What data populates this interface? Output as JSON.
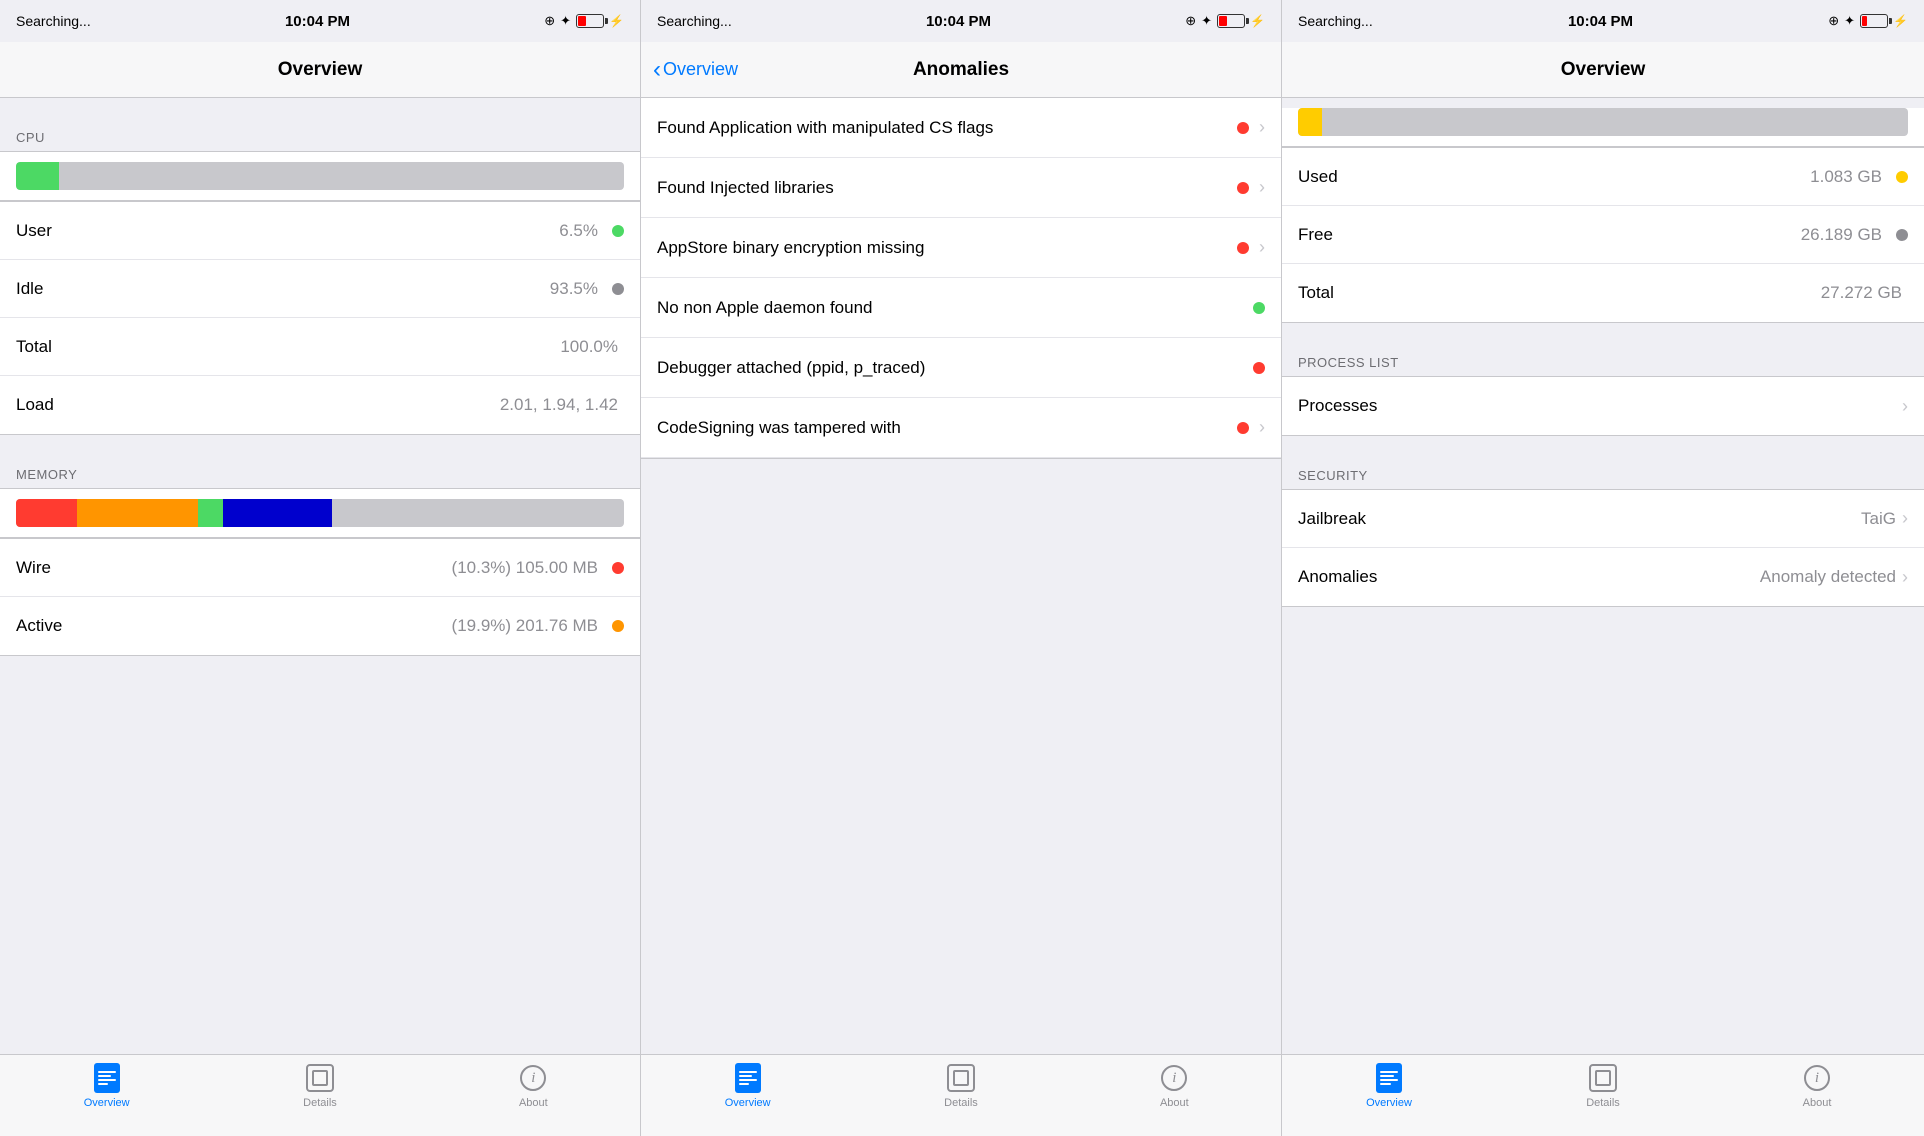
{
  "panels": [
    {
      "id": "panel-1",
      "statusBar": {
        "left": "Searching...",
        "center": "10:04 PM",
        "right": "⊕ ✦ 🔋 ⚡"
      },
      "navTitle": "Overview",
      "navBack": null,
      "sections": [
        {
          "type": "header",
          "label": ""
        },
        {
          "type": "section-label",
          "label": "CPU"
        },
        {
          "type": "cpu-bar"
        },
        {
          "type": "list",
          "items": [
            {
              "label": "User",
              "value": "6.5%",
              "dot": "green"
            },
            {
              "label": "Idle",
              "value": "93.5%",
              "dot": "gray"
            },
            {
              "label": "Total",
              "value": "100.0%",
              "dot": null
            },
            {
              "label": "Load",
              "value": "2.01, 1.94, 1.42",
              "dot": null
            }
          ]
        },
        {
          "type": "section-label",
          "label": "MEMORY"
        },
        {
          "type": "memory-bar"
        },
        {
          "type": "list",
          "items": [
            {
              "label": "Wire",
              "value": "(10.3%) 105.00 MB",
              "dot": "red"
            },
            {
              "label": "Active",
              "value": "(19.9%) 201.76 MB",
              "dot": "orange"
            }
          ]
        }
      ],
      "tabs": [
        {
          "label": "Overview",
          "icon": "overview",
          "active": true
        },
        {
          "label": "Details",
          "icon": "details",
          "active": false
        },
        {
          "label": "About",
          "icon": "about",
          "active": false
        }
      ]
    },
    {
      "id": "panel-2",
      "statusBar": {
        "left": "Searching...",
        "center": "10:04 PM",
        "right": "⊕ ✦ 🔋 ⚡"
      },
      "navTitle": "Anomalies",
      "navBack": "Overview",
      "sections": [
        {
          "type": "anomaly-list",
          "items": [
            {
              "label": "Found Application with manipulated CS flags",
              "dot": "red",
              "chevron": true
            },
            {
              "label": "Found Injected libraries",
              "dot": "red",
              "chevron": true
            },
            {
              "label": "AppStore binary encryption missing",
              "dot": "red",
              "chevron": true
            },
            {
              "label": "No non Apple daemon found",
              "dot": "green",
              "chevron": false
            },
            {
              "label": "Debugger attached (ppid, p_traced)",
              "dot": "red",
              "chevron": false
            },
            {
              "label": "CodeSigning was tampered with",
              "dot": "red",
              "chevron": true
            }
          ]
        }
      ],
      "tabs": [
        {
          "label": "Overview",
          "icon": "overview",
          "active": true
        },
        {
          "label": "Details",
          "icon": "details",
          "active": false
        },
        {
          "label": "About",
          "icon": "about",
          "active": false
        }
      ]
    },
    {
      "id": "panel-3",
      "statusBar": {
        "left": "Searching...",
        "center": "10:04 PM",
        "right": "⊕ ✦ 🔋 ⚡"
      },
      "navTitle": "Overview",
      "navBack": null,
      "sections": [
        {
          "type": "storage-bar"
        },
        {
          "type": "list",
          "items": [
            {
              "label": "Used",
              "value": "1.083 GB",
              "dot": "yellow"
            },
            {
              "label": "Free",
              "value": "26.189 GB",
              "dot": "gray"
            },
            {
              "label": "Total",
              "value": "27.272 GB",
              "dot": null
            }
          ]
        },
        {
          "type": "section-label",
          "label": "PROCESS LIST"
        },
        {
          "type": "list",
          "items": [
            {
              "label": "Processes",
              "value": "",
              "dot": null,
              "chevron": true
            }
          ]
        },
        {
          "type": "section-label",
          "label": "SECURITY"
        },
        {
          "type": "list",
          "items": [
            {
              "label": "Jailbreak",
              "value": "TaiG",
              "dot": null,
              "chevron": true
            },
            {
              "label": "Anomalies",
              "value": "Anomaly detected",
              "dot": null,
              "chevron": true
            }
          ]
        }
      ],
      "tabs": [
        {
          "label": "Overview",
          "icon": "overview",
          "active": true
        },
        {
          "label": "Details",
          "icon": "details",
          "active": false
        },
        {
          "label": "About",
          "icon": "about",
          "active": false
        }
      ]
    }
  ]
}
